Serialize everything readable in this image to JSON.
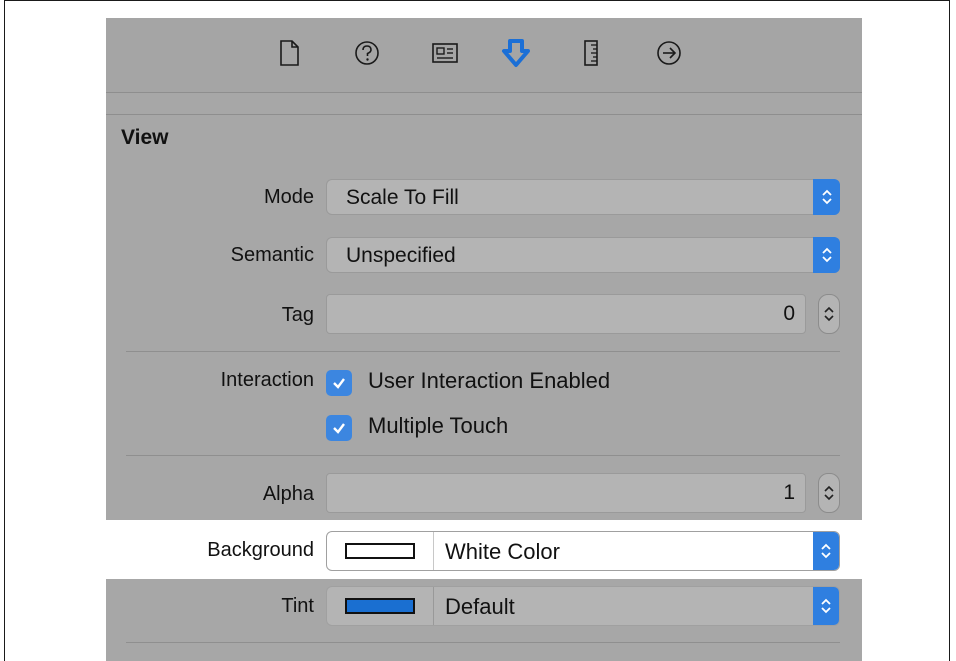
{
  "toolbar": {
    "icons": [
      "file-icon",
      "help-icon",
      "identity-icon",
      "attributes-icon",
      "size-icon",
      "connections-icon"
    ],
    "active_icon": "attributes-icon",
    "accent_color": "#1b6fd6"
  },
  "section": {
    "title": "View"
  },
  "mode": {
    "label": "Mode",
    "value": "Scale To Fill"
  },
  "semantic": {
    "label": "Semantic",
    "value": "Unspecified"
  },
  "tag": {
    "label": "Tag",
    "value": "0"
  },
  "interaction": {
    "label": "Interaction",
    "user_interaction": {
      "label": "User Interaction Enabled",
      "checked": true
    },
    "multiple_touch": {
      "label": "Multiple Touch",
      "checked": true
    }
  },
  "alpha": {
    "label": "Alpha",
    "value": "1"
  },
  "background": {
    "label": "Background",
    "value": "White Color",
    "swatch_color": "#ffffff"
  },
  "tint": {
    "label": "Tint",
    "value": "Default",
    "swatch_color": "#1a6fd1"
  }
}
